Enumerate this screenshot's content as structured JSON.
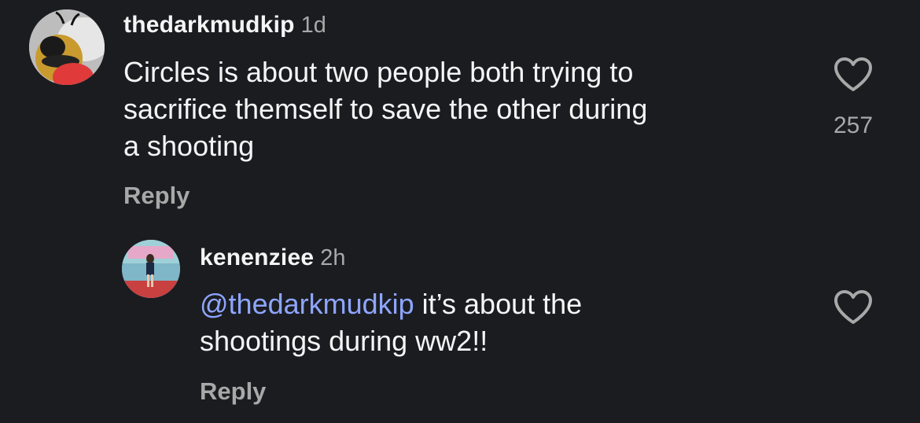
{
  "comments": [
    {
      "username": "thedarkmudkip",
      "time": "1d",
      "lines": [
        "Circles is about two people both trying to",
        "sacrifice themself to save the other during",
        "a shooting"
      ],
      "reply_label": "Reply",
      "like_count": "257",
      "like_icon": "heart-outline-icon"
    },
    {
      "username": "kenenziee",
      "time": "2h",
      "mention": "@thedarkmudkip",
      "lines": [
        " it’s about the",
        "shootings during ww2!!"
      ],
      "reply_label": "Reply",
      "like_icon": "heart-outline-icon"
    }
  ],
  "colors": {
    "background": "#1b1c20",
    "primary_text": "#f5f5f5",
    "secondary_text": "#a8a8a8",
    "mention": "#8ea6ff"
  }
}
